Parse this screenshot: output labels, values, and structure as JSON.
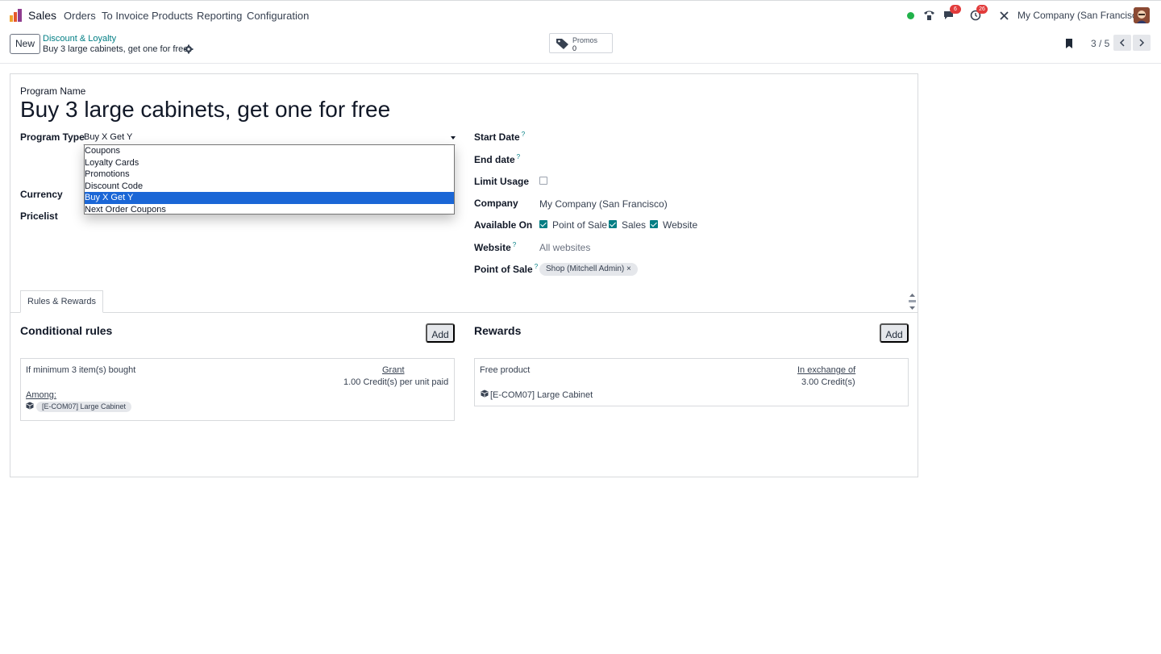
{
  "navbar": {
    "app_name": "Sales",
    "menu": [
      "Orders",
      "To Invoice",
      "Products",
      "Reporting",
      "Configuration"
    ],
    "messages_badge": "6",
    "activities_badge": "26",
    "company": "My Company (San Francisco)"
  },
  "control_panel": {
    "new_label": "New",
    "breadcrumb_parent": "Discount & Loyalty",
    "breadcrumb_current": "Buy 3 large cabinets, get one for free",
    "smart_button": {
      "label": "Promos",
      "value": "0"
    },
    "pager": "3 / 5"
  },
  "form": {
    "program_name_label": "Program Name",
    "program_name": "Buy 3 large cabinets, get one for free",
    "program_type_label": "Program Type",
    "program_type_value": "Buy X Get Y",
    "program_type_options": [
      "Coupons",
      "Loyalty Cards",
      "Promotions",
      "Discount Code",
      "Buy X Get Y",
      "Next Order Coupons"
    ],
    "currency_label": "Currency",
    "pricelist_label": "Pricelist",
    "start_date_label": "Start Date",
    "end_date_label": "End date",
    "limit_usage_label": "Limit Usage",
    "company_label": "Company",
    "company_value": "My Company (San Francisco)",
    "available_on_label": "Available On",
    "available_on": [
      {
        "label": "Point of Sale",
        "checked": true
      },
      {
        "label": "Sales",
        "checked": true
      },
      {
        "label": "Website",
        "checked": true
      }
    ],
    "website_label": "Website",
    "website_placeholder": "All websites",
    "pos_label": "Point of Sale",
    "pos_tag": "Shop (Mitchell Admin)",
    "help_mark": "?"
  },
  "tabs": {
    "rules_rewards": "Rules & Rewards"
  },
  "rules": {
    "title": "Conditional rules",
    "add_label": "Add",
    "condition": "If minimum 3 item(s) bought",
    "grant_label": "Grant",
    "grant_value": "1.00 Credit(s) per unit paid",
    "among_label": "Among:",
    "product_tag": "[E-COM07] Large Cabinet"
  },
  "rewards": {
    "title": "Rewards",
    "add_label": "Add",
    "reward": "Free product",
    "exchange_label": "In exchange of",
    "exchange_value": "3.00 Credit(s)",
    "product": "[E-COM07] Large Cabinet"
  },
  "colors": {
    "accent": "#017e84",
    "selected_option": "#1a66d6",
    "badge": "#e23b3b",
    "online": "#21b24a"
  }
}
